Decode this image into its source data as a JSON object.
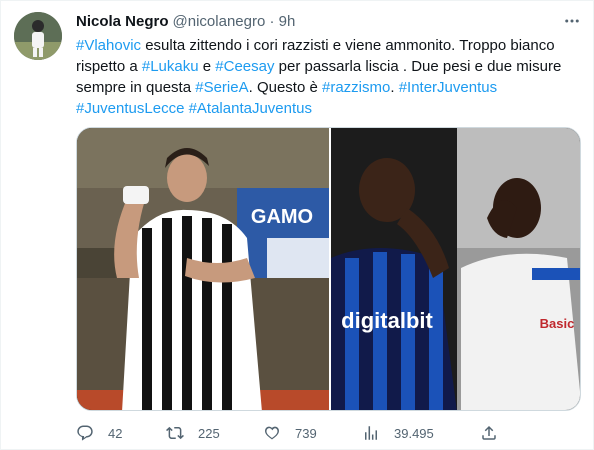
{
  "tweet": {
    "author_name": "Nicola Negro",
    "handle_time": "@nicolanegro · 9h",
    "text_segments": [
      {
        "t": "#Vlahovic",
        "tag": true
      },
      {
        "t": " esulta zittendo i cori razzisti e viene ammonito. Troppo bianco rispetto a ",
        "tag": false
      },
      {
        "t": "#Lukaku",
        "tag": true
      },
      {
        "t": " e ",
        "tag": false
      },
      {
        "t": "#Ceesay",
        "tag": true
      },
      {
        "t": " per passarla liscia . Due pesi e due misure sempre in questa ",
        "tag": false
      },
      {
        "t": "#SerieA",
        "tag": true
      },
      {
        "t": ". Questo è ",
        "tag": false
      },
      {
        "t": "#razzismo",
        "tag": true
      },
      {
        "t": ". ",
        "tag": false
      },
      {
        "t": "#InterJuventus",
        "tag": true
      },
      {
        "t": " ",
        "tag": false
      },
      {
        "t": "#JuventusLecce",
        "tag": true
      },
      {
        "t": " ",
        "tag": false
      },
      {
        "t": "#AtalantaJuventus",
        "tag": true
      }
    ],
    "media": {
      "left_image": "vlahovic-celebration-photo",
      "right_image": "lukaku-ceesay-celebration-photo",
      "jersey_sponsor": "digitalbit",
      "banner_text": "GAMO"
    },
    "stats": {
      "replies": "42",
      "retweets": "225",
      "likes": "739",
      "views": "39.495"
    }
  },
  "colors": {
    "link": "#1d9bf0",
    "text": "#0f1419",
    "secondary": "#536471"
  }
}
